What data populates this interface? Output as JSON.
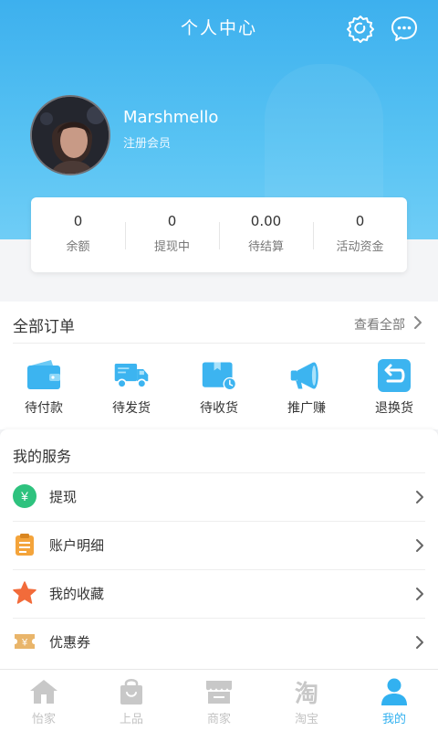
{
  "header": {
    "title": "个人中心",
    "settings_icon": "gear-icon",
    "message_icon": "chat-bubble-icon"
  },
  "profile": {
    "username": "Marshmello",
    "member_level": "注册会员"
  },
  "stats": [
    {
      "value": "0",
      "label": "余额"
    },
    {
      "value": "0",
      "label": "提现中"
    },
    {
      "value": "0.00",
      "label": "待结算"
    },
    {
      "value": "0",
      "label": "活动资金"
    }
  ],
  "orders": {
    "title": "全部订单",
    "view_all": "查看全部",
    "items": [
      {
        "label": "待付款",
        "icon": "wallet-icon"
      },
      {
        "label": "待发货",
        "icon": "truck-icon"
      },
      {
        "label": "待收货",
        "icon": "package-clock-icon"
      },
      {
        "label": "推广赚",
        "icon": "megaphone-icon"
      },
      {
        "label": "退换货",
        "icon": "return-arrow-icon"
      }
    ]
  },
  "services": {
    "title": "我的服务",
    "items": [
      {
        "label": "提现",
        "icon": "yuan-coin-icon"
      },
      {
        "label": "账户明细",
        "icon": "clipboard-icon"
      },
      {
        "label": "我的收藏",
        "icon": "star-icon"
      },
      {
        "label": "优惠券",
        "icon": "coupon-icon"
      }
    ]
  },
  "tabbar": {
    "items": [
      {
        "label": "怡家",
        "icon": "home-icon"
      },
      {
        "label": "上品",
        "icon": "shopping-bag-icon"
      },
      {
        "label": "商家",
        "icon": "store-icon"
      },
      {
        "label": "淘宝",
        "icon": "taobao-icon"
      },
      {
        "label": "我的",
        "icon": "person-icon"
      }
    ],
    "active_index": 4
  },
  "colors": {
    "accent": "#32b1f0",
    "header_top": "#3db0ee",
    "order_icon": "#3cb4f0",
    "withdraw_green": "#2ec27e",
    "detail_orange": "#f4a43b",
    "star_orange": "#f26b3a",
    "coupon_tan": "#e9b56a"
  }
}
